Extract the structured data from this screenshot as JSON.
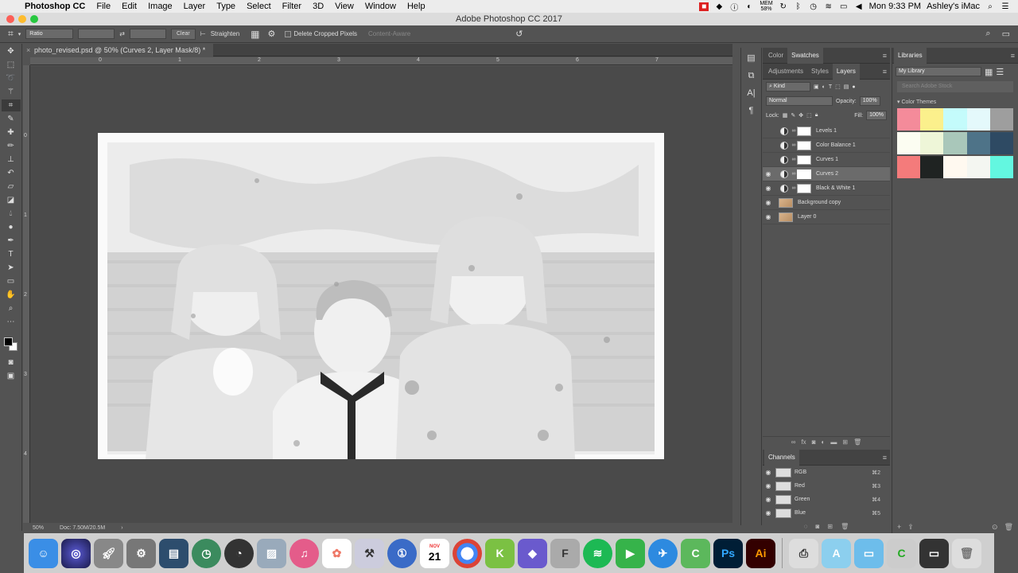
{
  "menubar": {
    "app": "Photoshop CC",
    "items": [
      "File",
      "Edit",
      "Image",
      "Layer",
      "Type",
      "Select",
      "Filter",
      "3D",
      "View",
      "Window",
      "Help"
    ],
    "mem_line1": "MEM",
    "mem_line2": "58%",
    "clock": "Mon 9:33 PM",
    "user": "Ashley's iMac"
  },
  "window": {
    "title": "Adobe Photoshop CC 2017"
  },
  "options_bar": {
    "ratio_label": "Ratio",
    "clear_label": "Clear",
    "straighten_label": "Straighten",
    "delete_cropped_label": "Delete Cropped Pixels",
    "content_aware_label": "Content-Aware"
  },
  "document": {
    "tab_title": "photo_revised.psd @ 50% (Curves 2, Layer Mask/8) *",
    "zoom": "50%",
    "doc_info": "Doc: 7.50M/20.5M",
    "ruler_top": [
      "0",
      "1",
      "2",
      "3",
      "4",
      "5",
      "6",
      "7"
    ],
    "ruler_left": [
      "0",
      "1",
      "2",
      "3",
      "4"
    ]
  },
  "panels": {
    "color_tabs": [
      "Color",
      "Swatches"
    ],
    "layer_tabs": [
      "Adjustments",
      "Styles",
      "Layers"
    ],
    "kind_label": "Kind",
    "blend_mode": "Normal",
    "opacity_label": "Opacity:",
    "opacity_value": "100%",
    "lock_label": "Lock:",
    "fill_label": "Fill:",
    "fill_value": "100%",
    "layers": [
      {
        "name": "Levels 1",
        "visible": false,
        "type": "adjustment",
        "selected": false
      },
      {
        "name": "Color Balance 1",
        "visible": false,
        "type": "adjustment",
        "selected": false
      },
      {
        "name": "Curves 1",
        "visible": false,
        "type": "adjustment",
        "selected": false
      },
      {
        "name": "Curves 2",
        "visible": true,
        "type": "adjustment",
        "selected": true
      },
      {
        "name": "Black & White 1",
        "visible": true,
        "type": "adjustment",
        "selected": false
      },
      {
        "name": "Background copy",
        "visible": true,
        "type": "pixel",
        "selected": false
      },
      {
        "name": "Layer 0",
        "visible": true,
        "type": "pixel",
        "selected": false
      }
    ],
    "channels_title": "Channels",
    "channels": [
      {
        "name": "RGB",
        "key": "⌘2"
      },
      {
        "name": "Red",
        "key": "⌘3"
      },
      {
        "name": "Green",
        "key": "⌘4"
      },
      {
        "name": "Blue",
        "key": "⌘5"
      }
    ]
  },
  "libraries": {
    "title": "Libraries",
    "library_name": "My Library",
    "search_placeholder": "Search Adobe Stock",
    "themes_label": "Color Themes",
    "themes": [
      [
        "#f48b9a",
        "#fbf08c",
        "#c4fbfb",
        "#e4f9fb",
        "#9e9e9e"
      ],
      [
        "#fcfdf2",
        "#eef6d8",
        "#a9c7ba",
        "#4e7388",
        "#2e4a63"
      ],
      [
        "#f47b7b",
        "#1f2322",
        "#fff9f0",
        "#f4f6f1",
        "#63f7e0"
      ]
    ]
  },
  "dock": {
    "calendar_month": "NOV",
    "calendar_day": "21",
    "ps_label": "Ps",
    "ai_label": "Ai"
  }
}
